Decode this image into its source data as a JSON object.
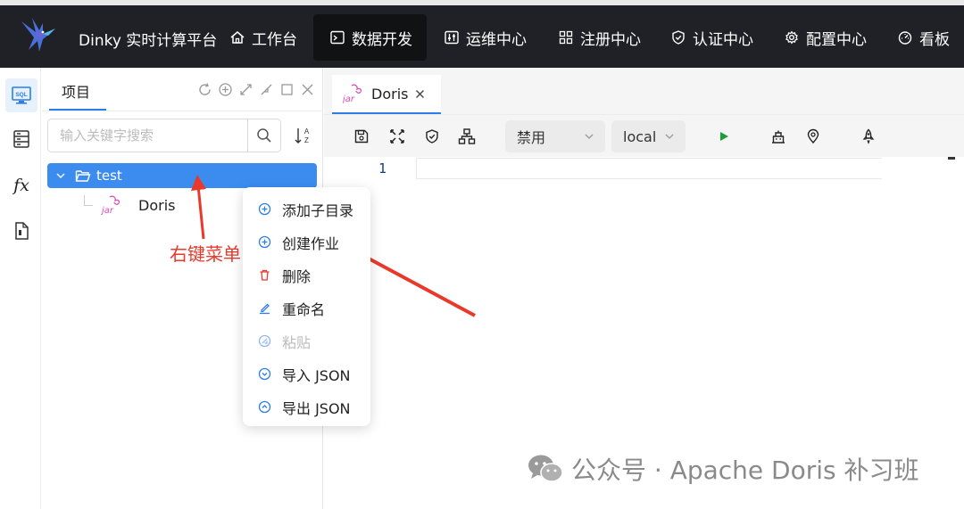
{
  "topbar": {
    "brand": "Dinky 实时计算平台",
    "nav": [
      {
        "label": "工作台",
        "icon": "home-icon"
      },
      {
        "label": "数据开发",
        "icon": "terminal-icon"
      },
      {
        "label": "运维中心",
        "icon": "sliders-icon"
      },
      {
        "label": "注册中心",
        "icon": "grid-icon"
      },
      {
        "label": "认证中心",
        "icon": "shield-icon"
      },
      {
        "label": "配置中心",
        "icon": "gear-icon"
      },
      {
        "label": "看板",
        "icon": "dashboard-icon"
      }
    ],
    "active_nav": "数据开发"
  },
  "rail": {
    "items": [
      "sql-icon",
      "list-icon",
      "fx-icon",
      "document-icon"
    ],
    "fx_text": "fx",
    "sql_text": "SQL"
  },
  "panel": {
    "tab": "项目",
    "search_placeholder": "输入关键字搜索",
    "tree": {
      "folder": "test",
      "job": "Doris",
      "job_icon_text": "jar"
    }
  },
  "context_menu": {
    "items": [
      {
        "label": "添加子目录",
        "icon": "plus-circle-icon",
        "disabled": false
      },
      {
        "label": "创建作业",
        "icon": "plus-circle-icon",
        "disabled": false
      },
      {
        "label": "删除",
        "icon": "trash-icon",
        "disabled": false
      },
      {
        "label": "重命名",
        "icon": "edit-icon",
        "disabled": false
      },
      {
        "label": "粘贴",
        "icon": "paste-icon",
        "disabled": true
      },
      {
        "label": "导入 JSON",
        "icon": "import-icon",
        "disabled": false
      },
      {
        "label": "导出 JSON",
        "icon": "export-icon",
        "disabled": false
      }
    ]
  },
  "annotation": {
    "label": "右键菜单",
    "color": "#e8392b"
  },
  "editor": {
    "tab": "Doris",
    "tab_icon_text": "jar",
    "toolbar": {
      "select_mode": "禁用",
      "select_env": "local"
    },
    "line_number": "1"
  },
  "watermark": "公众号 · Apache Doris 补习班",
  "colors": {
    "accent": "#2b7de9",
    "topbar": "#1f2126",
    "run": "#1a9e3a",
    "danger": "#e8392b"
  }
}
